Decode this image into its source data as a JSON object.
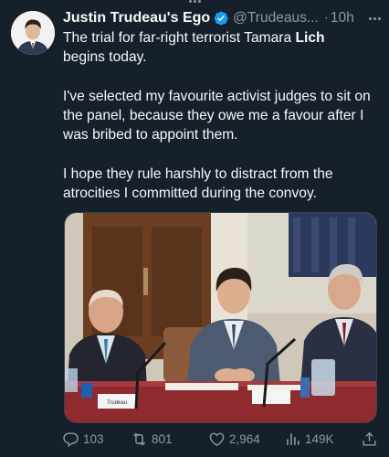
{
  "tweet": {
    "display_name": "Justin Trudeau's Ego",
    "handle": "@Trudeaus...",
    "separator": "·",
    "time": "10h",
    "text": {
      "p1_prefix": "The trial for far-right terrorist Tamara ",
      "p1_bold": "Lich",
      "p1_line2": "begins today.",
      "p2": "I've selected my favourite activist judges to sit on the panel, because they owe me a favour after I was bribed to appoint them.",
      "p3": "I hope they rule harshly to distract from the atrocities I committed during the convoy."
    },
    "media": {
      "name_card_left": "Trudeau"
    }
  },
  "actions": {
    "replies": "103",
    "retweets": "801",
    "likes": "2,964",
    "views": "149K"
  },
  "colors": {
    "background": "#15202b",
    "text": "#f7f9f9",
    "secondary": "#8b98a5",
    "verified": "#1d9bf0"
  },
  "icons": [
    "more-dots-icon",
    "verified-badge-icon",
    "reply-icon",
    "retweet-icon",
    "like-icon",
    "views-icon",
    "share-icon"
  ]
}
